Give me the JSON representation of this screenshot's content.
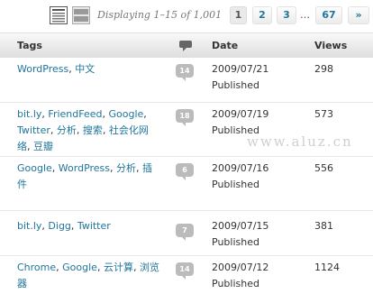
{
  "toolbar": {
    "displaying": "Displaying 1–15 of 1,001",
    "pages": [
      {
        "label": "1",
        "current": true
      },
      {
        "label": "2",
        "current": false
      },
      {
        "label": "3",
        "current": false
      }
    ],
    "dots": "…",
    "last_page": "67",
    "next": "»"
  },
  "columns": {
    "tags": "Tags",
    "date": "Date",
    "views": "Views"
  },
  "rows": [
    {
      "tags": [
        "WordPress",
        "中文"
      ],
      "comments": "14",
      "date": "2009/07/21",
      "status": "Published",
      "views": "298"
    },
    {
      "tags": [
        "bit.ly",
        "FriendFeed",
        "Google",
        "Twitter",
        "分析",
        "搜索",
        "社会化网络",
        "豆瓣"
      ],
      "comments": "18",
      "date": "2009/07/19",
      "status": "Published",
      "views": "573"
    },
    {
      "tags": [
        "Google",
        "WordPress",
        "分析",
        "插件"
      ],
      "comments": "6",
      "date": "2009/07/16",
      "status": "Published",
      "views": "556"
    },
    {
      "tags": [
        "bit.ly",
        "Digg",
        "Twitter"
      ],
      "comments": "7",
      "date": "2009/07/15",
      "status": "Published",
      "views": "381"
    },
    {
      "tags": [
        "Chrome",
        "Google",
        "云计算",
        "浏览器"
      ],
      "comments": "14",
      "date": "2009/07/12",
      "status": "Published",
      "views": "1124"
    }
  ],
  "watermark": "www.aluz.cn",
  "colors": {
    "link": "#21759b",
    "bubble": "#bbbbbb",
    "header_bg": "#dfdfdf"
  }
}
